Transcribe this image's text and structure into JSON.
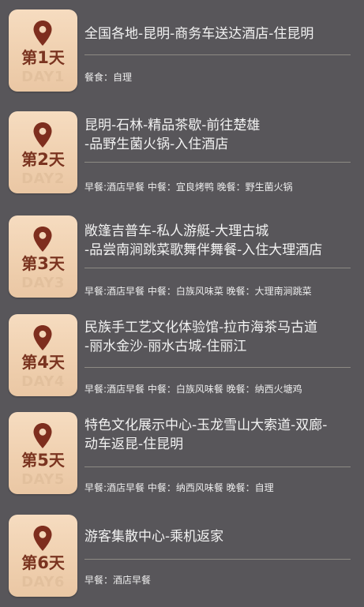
{
  "days": [
    {
      "title_prefix": "第",
      "title_num": "1",
      "title_suffix": "天",
      "sub": "DAY1",
      "route_lines": [
        "全国各地-昆明-商务车送达酒店-住昆明"
      ],
      "meals": "餐食：自理"
    },
    {
      "title_prefix": "第",
      "title_num": "2",
      "title_suffix": "天",
      "sub": "DAY2",
      "route_lines": [
        "昆明-石林-精品茶歇-前往楚雄",
        "-品野生菌火锅-入住酒店"
      ],
      "meals": "早餐:酒店早餐 中餐：宜良烤鸭 晚餐：野生菌火锅"
    },
    {
      "title_prefix": "第",
      "title_num": "3",
      "title_suffix": "天",
      "sub": "DAY3",
      "route_lines": [
        "敞篷吉普车-私人游艇-大理古城",
        "-品尝南涧跳菜歌舞伴舞餐-入住大理酒店"
      ],
      "meals": "早餐:酒店早餐 中餐：白族风味菜 晚餐：大理南涧跳菜"
    },
    {
      "title_prefix": "第",
      "title_num": "4",
      "title_suffix": "天",
      "sub": "DAY4",
      "route_lines": [
        "民族手工艺文化体验馆-拉市海茶马古道",
        "-丽水金沙-丽水古城-住丽江"
      ],
      "meals": "早餐:酒店早餐 中餐：白族风味餐 晚餐：纳西火塘鸡"
    },
    {
      "title_prefix": "第",
      "title_num": "5",
      "title_suffix": "天",
      "sub": "DAY5",
      "route_lines": [
        "特色文化展示中心-玉龙雪山大索道-双廊-",
        "动车返昆-住昆明"
      ],
      "meals": "早餐:酒店早餐 中餐：纳西风味餐 晚餐：自理"
    },
    {
      "title_prefix": "第",
      "title_num": "6",
      "title_suffix": "天",
      "sub": "DAY6",
      "route_lines": [
        "游客集散中心-乘机返家"
      ],
      "meals": "早餐：酒店早餐"
    }
  ],
  "colors": {
    "background": "#58565a",
    "badge_gradient_top": "#f6dcc0",
    "badge_gradient_bottom": "#eac7a4",
    "badge_title": "#7a3420",
    "badge_sub": "#e2c09d",
    "pin": "#7e2e1e",
    "text": "#f2f2f2",
    "divider": "#8d8a84"
  },
  "icons": {
    "badge_icon": "map-pin-icon"
  }
}
